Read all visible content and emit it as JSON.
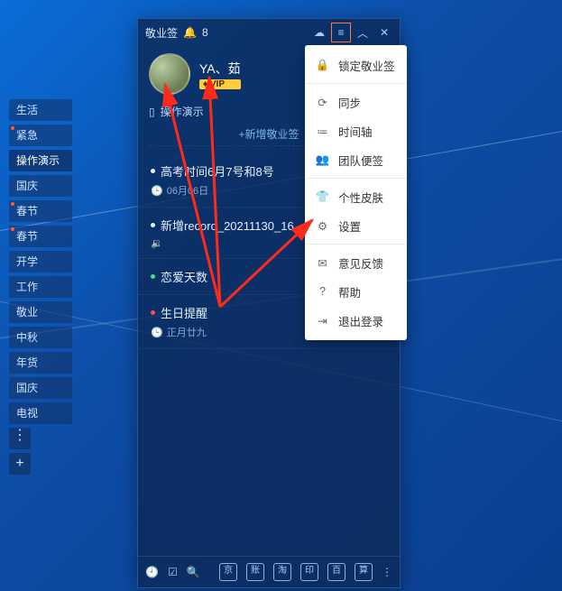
{
  "titlebar": {
    "app_name": "敬业签",
    "notif_count": "8"
  },
  "user": {
    "name": "YA、茹",
    "vip_text": "♦ VIP"
  },
  "sidebar": {
    "tabs": [
      "生活",
      "紧急",
      "操作演示",
      "国庆",
      "春节",
      "春节",
      "开学",
      "工作",
      "敬业",
      "中秋",
      "年货",
      "国庆",
      "电视"
    ]
  },
  "section": {
    "title": "操作演示",
    "add_placeholder": "+新增敬业签"
  },
  "notes": [
    {
      "text": "高考时间6月7号和8号",
      "sub": "06月06日"
    },
    {
      "text": "新增record_20211130_16…",
      "sub": ""
    },
    {
      "text": "恋爱天数",
      "sub": ""
    },
    {
      "text": "生日提醒",
      "sub": "正月廿九"
    }
  ],
  "menu": [
    "锁定敬业签",
    "同步",
    "时间轴",
    "团队便签",
    "个性皮肤",
    "设置",
    "意见反馈",
    "帮助",
    "退出登录"
  ],
  "bottom": {
    "tiles": [
      "京",
      "账",
      "淘",
      "印",
      "百",
      "算"
    ]
  },
  "colors": {
    "accent_arrow": "#ff2a1a",
    "vip_badge": "#ffcc3b",
    "app_bg": "rgba(12,40,85,0.78)"
  }
}
